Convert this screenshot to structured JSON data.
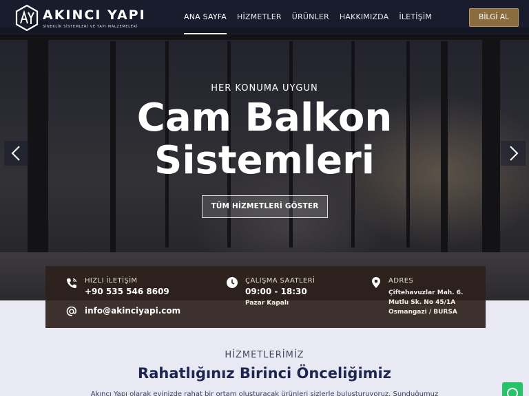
{
  "brand": {
    "logo_letters": "AY",
    "name": "AKINCI YAPI",
    "tagline": "SİNEKLİK SİSTEMLERİ VE YAPI MALZEMELERİ"
  },
  "nav": {
    "items": [
      {
        "label": "ANA SAYFA",
        "active": true
      },
      {
        "label": "HİZMETLER",
        "active": false
      },
      {
        "label": "ÜRÜNLER",
        "active": false
      },
      {
        "label": "HAKKIMIZDA",
        "active": false
      },
      {
        "label": "İLETİŞİM",
        "active": false
      }
    ],
    "cta_label": "BİLGİ AL"
  },
  "hero": {
    "subtitle": "HER KONUMA UYGUN",
    "title_line1": "Cam Balkon",
    "title_line2": "Sistemleri",
    "button_label": "TÜM HİZMETLERİ GÖSTER",
    "prev_icon": "chevron-left-icon",
    "next_icon": "chevron-right-icon"
  },
  "info": {
    "contact": {
      "label": "HIZLI İLETİŞİM",
      "phone": "+90 535 546 8609",
      "email": "info@akinciyapi.com"
    },
    "hours": {
      "label": "ÇALIŞMA SAATLERİ",
      "time": "09:00 - 18:30",
      "note": "Pazar Kapalı"
    },
    "address": {
      "label": "ADRES",
      "lines": [
        "Çiftehavuzlar Mah. 6.",
        "Mutlu Sk. No 45/1A",
        "Osmangazi / BURSA"
      ]
    }
  },
  "services": {
    "kicker": "HİZMETLERİMİZ",
    "title": "Rahatlığınız Birinci Önceliğimiz",
    "text": "Akıncı Yapı olarak evinizde rahat bir ortam oluşturacak ürünleri sizlerle buluşturuyoruz. Sunduğumuz"
  },
  "colors": {
    "accent": "#8b6c3e",
    "navy": "#1d2550",
    "whatsapp": "#25c468"
  }
}
